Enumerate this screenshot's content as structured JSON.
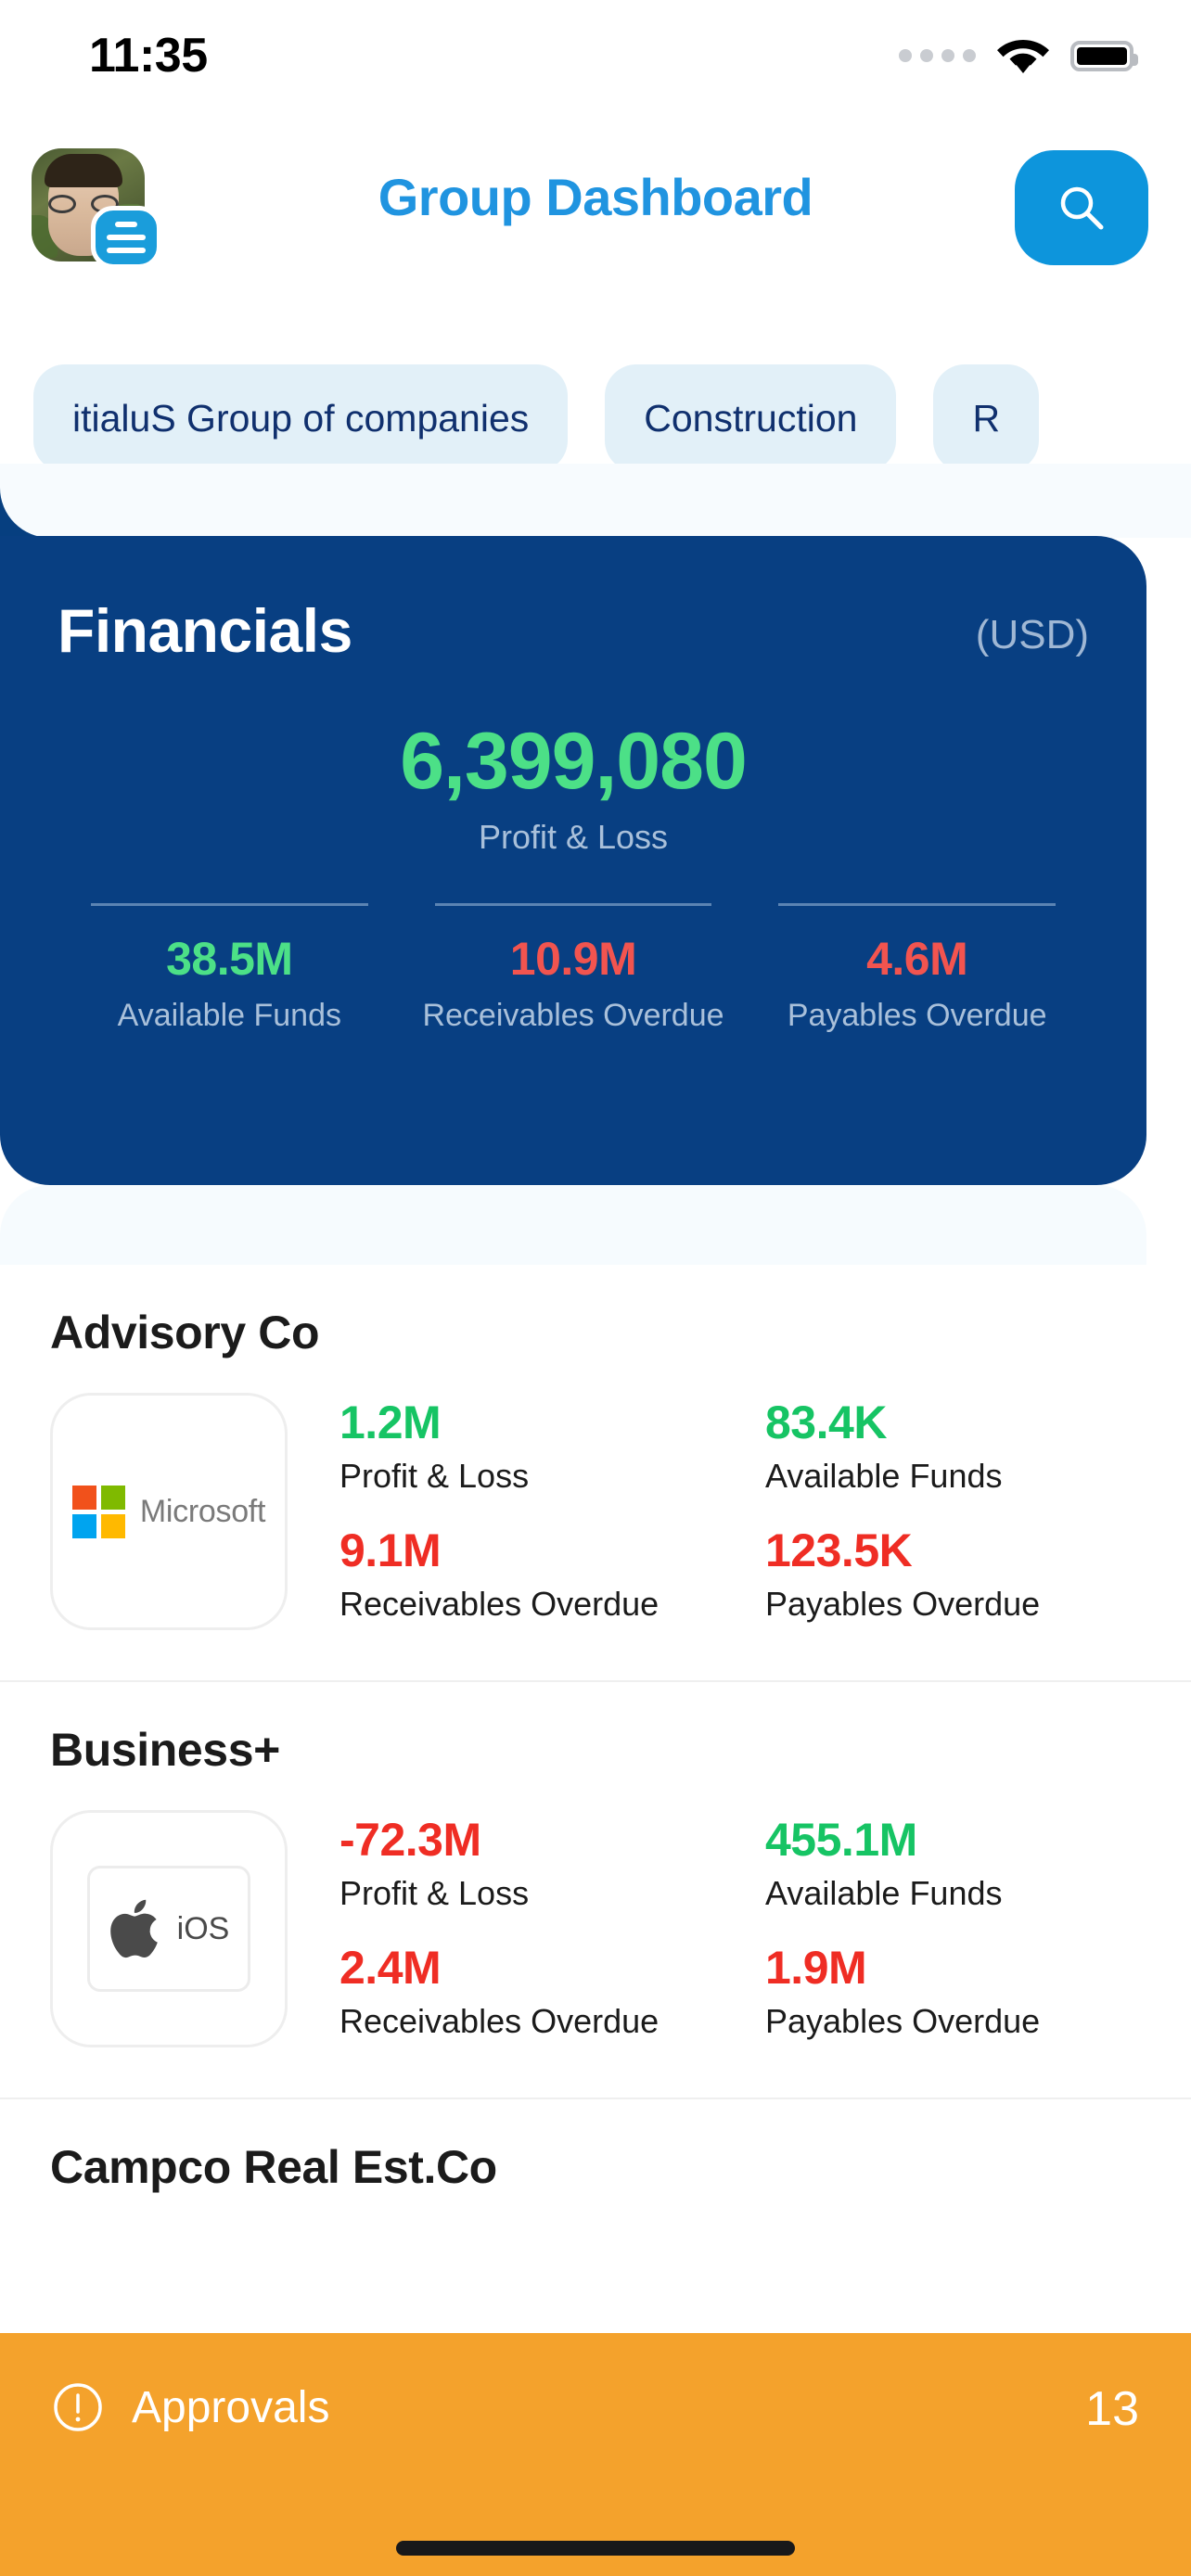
{
  "status_bar": {
    "time": "11:35",
    "signal_icon": "cellular-dots-icon",
    "wifi_icon": "wifi-icon",
    "battery_icon": "battery-full-icon"
  },
  "header": {
    "title": "Group Dashboard",
    "title_color": "#2094e0",
    "avatar_name": "user-avatar",
    "avatar_badge_icon": "menu-lines-icon",
    "search_icon": "search-icon",
    "search_bg": "#0d95dc"
  },
  "chips": [
    {
      "label": "itialuS Group of companies"
    },
    {
      "label": "Construction"
    },
    {
      "label": "R"
    }
  ],
  "financials": {
    "title": "Financials",
    "currency": "(USD)",
    "card_bg": "#083f82",
    "hero": {
      "value": "6,399,080",
      "label": "Profit & Loss",
      "tone": "positive"
    },
    "metrics": [
      {
        "value": "38.5M",
        "label": "Available Funds",
        "tone": "positive"
      },
      {
        "value": "10.9M",
        "label": "Receivables Overdue",
        "tone": "negative"
      },
      {
        "value": "4.6M",
        "label": "Payables Overdue",
        "tone": "negative"
      }
    ],
    "positive_color": "#4ce087",
    "negative_color": "#f2544f"
  },
  "companies": [
    {
      "name": "Advisory Co",
      "logo": {
        "type": "microsoft-logo",
        "word": "Microsoft"
      },
      "kpis": [
        {
          "value": "1.2M",
          "label": "Profit & Loss",
          "tone": "positive"
        },
        {
          "value": "83.4K",
          "label": "Available Funds",
          "tone": "positive"
        },
        {
          "value": "9.1M",
          "label": "Receivables Overdue",
          "tone": "negative"
        },
        {
          "value": "123.5K",
          "label": "Payables Overdue",
          "tone": "negative"
        }
      ]
    },
    {
      "name": "Business+",
      "logo": {
        "type": "apple-ios-logo",
        "word": "iOS"
      },
      "kpis": [
        {
          "value": "-72.3M",
          "label": "Profit & Loss",
          "tone": "negative"
        },
        {
          "value": "455.1M",
          "label": "Available Funds",
          "tone": "positive"
        },
        {
          "value": "2.4M",
          "label": "Receivables Overdue",
          "tone": "negative"
        },
        {
          "value": "1.9M",
          "label": "Payables Overdue",
          "tone": "negative"
        }
      ]
    },
    {
      "name": "Campco Real Est.Co",
      "logo": null,
      "kpis": []
    }
  ],
  "approvals_bar": {
    "icon": "exclamation-circle-icon",
    "label": "Approvals",
    "count": "13",
    "bg": "#f4a22c"
  }
}
